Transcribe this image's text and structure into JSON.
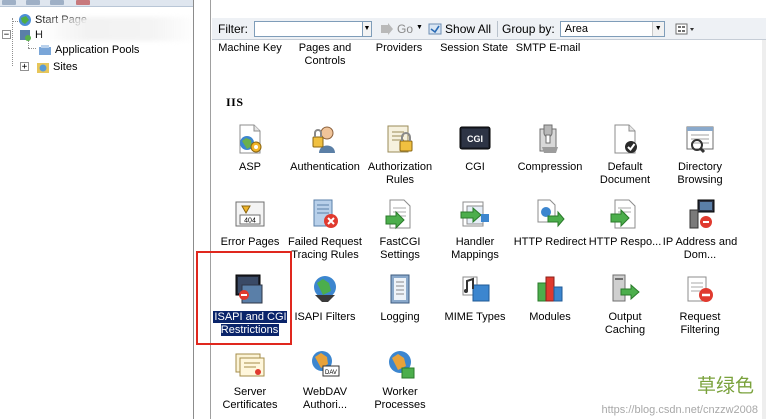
{
  "tree": {
    "items": [
      {
        "label": "Start Page",
        "icon": "start-page-icon",
        "expander": ""
      },
      {
        "label": "H",
        "icon": "server-icon",
        "expander": "−"
      },
      {
        "label": "Application Pools",
        "icon": "app-pools-icon",
        "expander": ""
      },
      {
        "label": "Sites",
        "icon": "sites-icon",
        "expander": "+"
      }
    ]
  },
  "filterbar": {
    "filter_label": "Filter:",
    "filter_value": "",
    "go_label": "Go",
    "show_all_label": "Show All",
    "group_by_label": "Group by:",
    "group_by_value": "Area"
  },
  "top_row": [
    {
      "label": "Machine Key"
    },
    {
      "label": "Pages and Controls"
    },
    {
      "label": "Providers"
    },
    {
      "label": "Session State"
    },
    {
      "label": "SMTP E-mail"
    }
  ],
  "section": {
    "title": "IIS"
  },
  "features": [
    {
      "label": "ASP",
      "icon": "asp-icon"
    },
    {
      "label": "Authentication",
      "icon": "authentication-icon"
    },
    {
      "label": "Authorization Rules",
      "icon": "authorization-rules-icon"
    },
    {
      "label": "CGI",
      "icon": "cgi-icon"
    },
    {
      "label": "Compression",
      "icon": "compression-icon"
    },
    {
      "label": "Default Document",
      "icon": "default-document-icon"
    },
    {
      "label": "Directory Browsing",
      "icon": "directory-browsing-icon"
    },
    {
      "label": "Error Pages",
      "icon": "error-pages-icon"
    },
    {
      "label": "Failed Request Tracing Rules",
      "icon": "failed-request-tracing-icon"
    },
    {
      "label": "FastCGI Settings",
      "icon": "fastcgi-icon"
    },
    {
      "label": "Handler Mappings",
      "icon": "handler-mappings-icon"
    },
    {
      "label": "HTTP Redirect",
      "icon": "http-redirect-icon"
    },
    {
      "label": "HTTP Respo...",
      "icon": "http-response-headers-icon"
    },
    {
      "label": "IP Address and Dom...",
      "icon": "ip-address-icon"
    },
    {
      "label": "ISAPI and CGI Restrictions",
      "icon": "isapi-cgi-restrictions-icon",
      "selected": true
    },
    {
      "label": "ISAPI Filters",
      "icon": "isapi-filters-icon"
    },
    {
      "label": "Logging",
      "icon": "logging-icon"
    },
    {
      "label": "MIME Types",
      "icon": "mime-types-icon"
    },
    {
      "label": "Modules",
      "icon": "modules-icon"
    },
    {
      "label": "Output Caching",
      "icon": "output-caching-icon"
    },
    {
      "label": "Request Filtering",
      "icon": "request-filtering-icon"
    },
    {
      "label": "Server Certificates",
      "icon": "server-certificates-icon"
    },
    {
      "label": "WebDAV Authori...",
      "icon": "webdav-icon"
    },
    {
      "label": "Worker Processes",
      "icon": "worker-processes-icon"
    }
  ],
  "icon_texts": {
    "cgi": "CGI",
    "error_code": "404",
    "dav": "DAV"
  },
  "watermark": {
    "text": "草绿色",
    "credit": "https://blog.csdn.net/cnzzw2008"
  },
  "colors": {
    "selection": "#0a246a",
    "highlight_border": "#e0281e",
    "watermark": "#7aa23c"
  }
}
